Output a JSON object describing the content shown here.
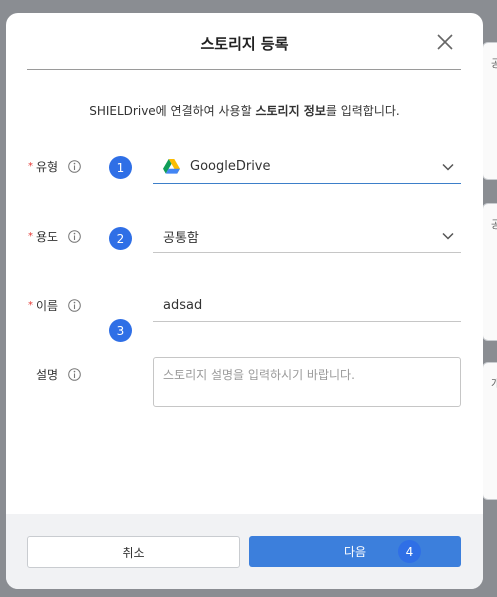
{
  "background": {
    "peek_texts": [
      "공",
      "공",
      "개"
    ]
  },
  "modal": {
    "title": "스토리지 등록",
    "description_prefix": "SHIELDrive에 연결하여 사용할 ",
    "description_bold": "스토리지 정보",
    "description_suffix": "를 입력합니다."
  },
  "fields": {
    "type": {
      "label": "유형",
      "required": "*",
      "value": "GoogleDrive",
      "step": "1"
    },
    "usage": {
      "label": "용도",
      "required": "*",
      "value": "공통함",
      "step": "2"
    },
    "name": {
      "label": "이름",
      "required": "*",
      "value": "adsad",
      "step": "3"
    },
    "description": {
      "label": "설명",
      "placeholder": "스토리지 설명을 입력하시기 바랍니다."
    }
  },
  "footer": {
    "cancel_label": "취소",
    "next_label": "다음",
    "next_step": "4"
  },
  "colors": {
    "accent": "#2f6fe6",
    "primary_button": "#3c7fdc",
    "required": "#e53935"
  }
}
